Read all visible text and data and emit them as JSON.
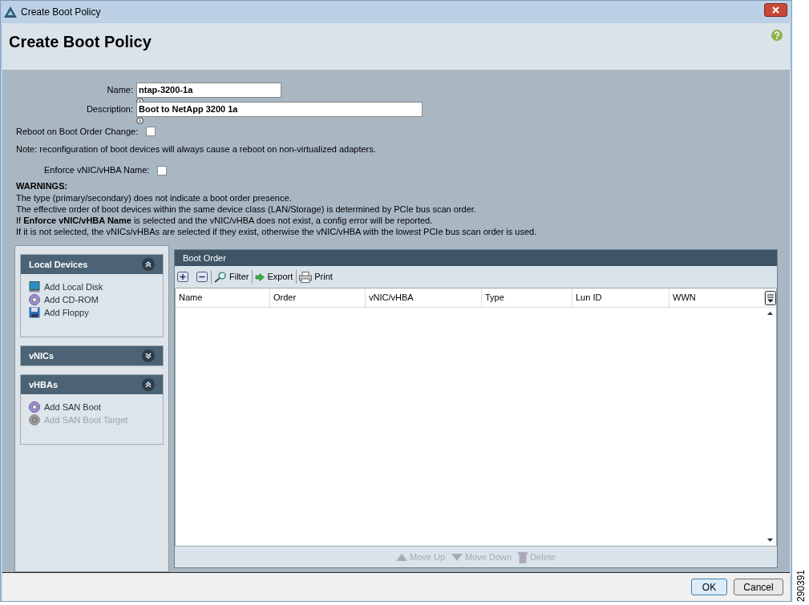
{
  "window": {
    "title": "Create Boot Policy"
  },
  "header": {
    "title": "Create Boot Policy"
  },
  "form": {
    "name": {
      "label": "Name:",
      "value": "ntap-3200-1a"
    },
    "description": {
      "label": "Description:",
      "value": "Boot to NetApp 3200 1a"
    },
    "reboot": {
      "label": "Reboot on Boot Order Change:",
      "checked": false
    },
    "note": "Note: reconfiguration of boot devices will always cause a reboot on non-virtualized adapters.",
    "enforce": {
      "label": "Enforce vNIC/vHBA Name:",
      "checked": false
    },
    "warnings_title": "WARNINGS:",
    "warnings": [
      "The type (primary/secondary) does not indicate a boot order presence.",
      "The effective order of boot devices within the same device class (LAN/Storage) is determined by PCIe bus scan order.",
      "If **Enforce vNIC/vHBA Name** is selected and the vNIC/vHBA does not exist, a config error will be reported.",
      "If it is not selected, the vNICs/vHBAs are selected if they exist, otherwise the vNIC/vHBA with the lowest PCIe bus scan order is used."
    ]
  },
  "sections": [
    {
      "title": "Local Devices",
      "expanded": true,
      "items": [
        {
          "label": "Add Local Disk",
          "kind": "disk",
          "disabled": false
        },
        {
          "label": "Add CD-ROM",
          "kind": "cd",
          "disabled": false
        },
        {
          "label": "Add Floppy",
          "kind": "floppy",
          "disabled": false
        }
      ]
    },
    {
      "title": "vNICs",
      "expanded": false
    },
    {
      "title": "vHBAs",
      "expanded": true,
      "items": [
        {
          "label": "Add SAN Boot",
          "kind": "cd",
          "disabled": false
        },
        {
          "label": "Add SAN Boot Target",
          "kind": "cd",
          "disabled": true
        }
      ]
    }
  ],
  "boot_order": {
    "title": "Boot Order",
    "toolbar": [
      {
        "label": "Filter",
        "kind": "filter"
      },
      {
        "label": "Export",
        "kind": "export"
      },
      {
        "label": "Print",
        "kind": "print"
      }
    ],
    "columns": [
      "Name",
      "Order",
      "vNIC/vHBA",
      "Type",
      "Lun ID",
      "WWN"
    ],
    "actions": [
      {
        "label": "Move Up",
        "kind": "up",
        "disabled": true
      },
      {
        "label": "Move Down",
        "kind": "down",
        "disabled": true
      },
      {
        "label": "Delete",
        "kind": "delete",
        "disabled": true
      }
    ]
  },
  "buttons": [
    {
      "label": "OK",
      "kind": "default"
    },
    {
      "label": "Cancel",
      "kind": "normal"
    }
  ],
  "figure_number": "290391"
}
